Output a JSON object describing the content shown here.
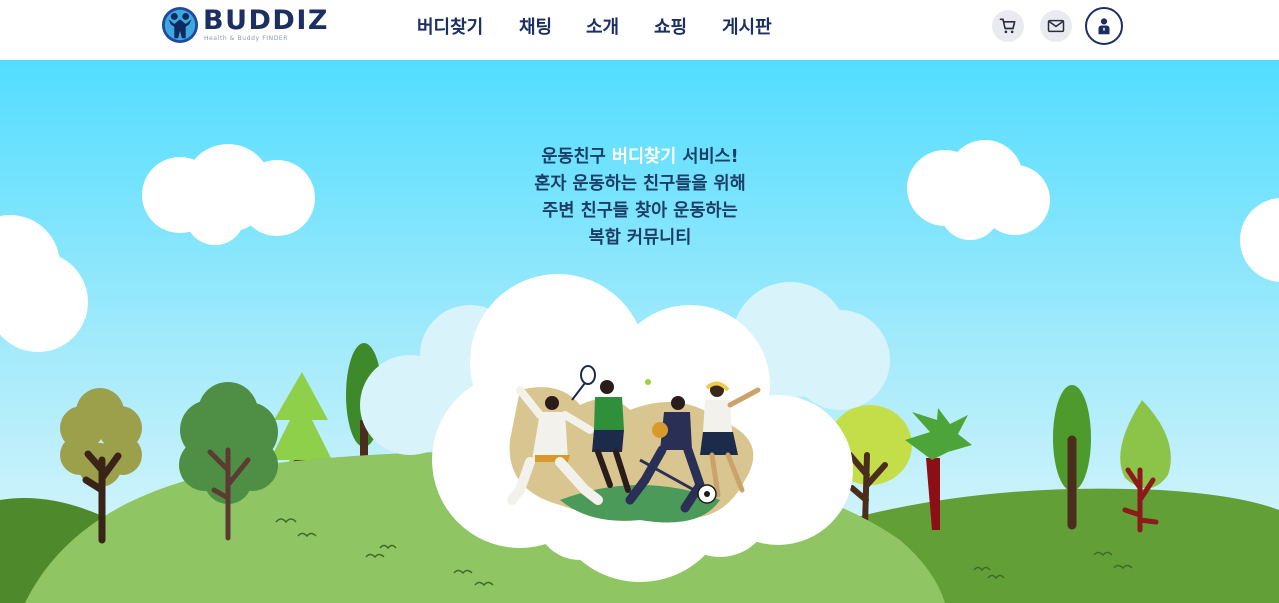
{
  "header": {
    "logo": {
      "name": "BUDDIZ",
      "subtitle": "Health & Buddy FINDER"
    },
    "nav": [
      {
        "label": "버디찾기"
      },
      {
        "label": "채팅"
      },
      {
        "label": "소개"
      },
      {
        "label": "쇼핑"
      },
      {
        "label": "게시판"
      }
    ],
    "icons": [
      "cart-icon",
      "mail-icon",
      "user-icon"
    ]
  },
  "hero": {
    "tagline": {
      "line1_pre": "운동친구 ",
      "line1_highlight": "버디찾기",
      "line1_post": " 서비스!",
      "line2": "혼자 운동하는 친구들을 위해",
      "line3": "주변 친구들 찾아 운동하는",
      "line4": "복합 커뮤니티"
    }
  },
  "colors": {
    "brand_navy": "#1c2f63",
    "sky_top": "#52ddff",
    "sky_bottom": "#dff6fb",
    "hill_green": "#8fc563",
    "hill_dark": "#4e8a2b"
  }
}
